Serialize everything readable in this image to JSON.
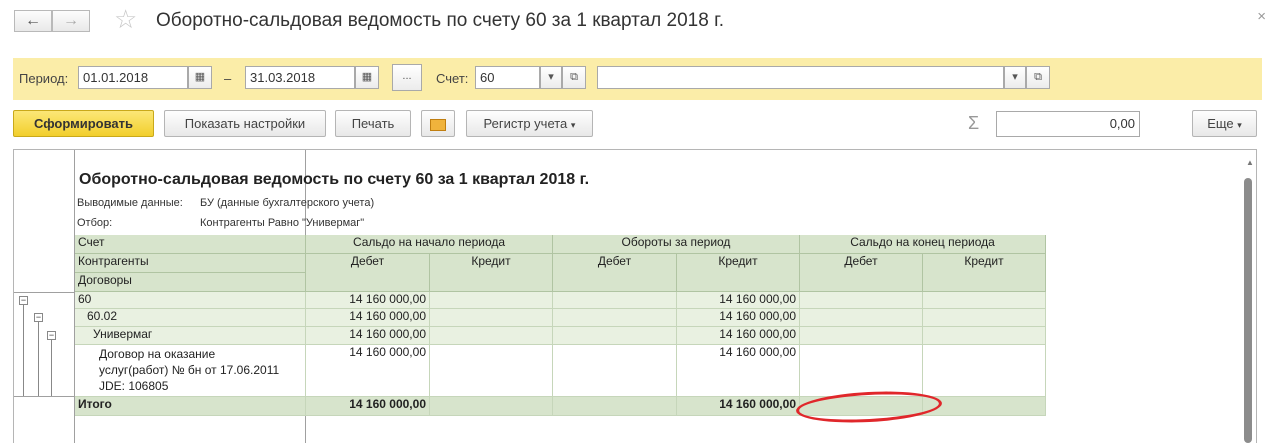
{
  "window": {
    "title": "Оборотно-сальдовая ведомость по счету 60 за 1 квартал 2018 г.",
    "back_icon": "←",
    "forward_icon": "→",
    "star_icon": "☆",
    "close_icon": "×"
  },
  "filters": {
    "period_label": "Период:",
    "date_from": "01.01.2018",
    "dash": "–",
    "date_to": "31.03.2018",
    "ellipsis_label": "...",
    "account_label": "Счет:",
    "account_value": "60",
    "subconto_value": ""
  },
  "toolbar": {
    "generate_label": "Сформировать",
    "settings_label": "Показать настройки",
    "print_label": "Печать",
    "register_label": "Регистр учета",
    "sum_icon": "Σ",
    "sum_value": "0,00",
    "more_label": "Еще"
  },
  "report": {
    "title": "Оборотно-сальдовая ведомость по счету 60 за 1 квартал 2018 г.",
    "output_label": "Выводимые данные:",
    "output_value": "БУ (данные бухгалтерского учета)",
    "filter_label": "Отбор:",
    "filter_value": "Контрагенты Равно \"Универмаг\"",
    "headers": {
      "account": "Счет",
      "counterparty": "Контрагенты",
      "contract": "Договоры",
      "opening_balance": "Сальдо на начало периода",
      "turnover": "Обороты за период",
      "closing_balance": "Сальдо на конец периода",
      "debit": "Дебет",
      "credit": "Кредит"
    },
    "rows": [
      {
        "name": "60",
        "open_debit": "14 160 000,00",
        "turn_credit": "14 160 000,00"
      },
      {
        "name": "60.02",
        "open_debit": "14 160 000,00",
        "turn_credit": "14 160 000,00"
      },
      {
        "name": "Универмаг",
        "open_debit": "14 160 000,00",
        "turn_credit": "14 160 000,00"
      },
      {
        "name_lines": [
          "Договор на оказание",
          "услуг(работ) № бн от 17.06.2011",
          "JDE: 106805"
        ],
        "open_debit": "14 160 000,00",
        "turn_credit": "14 160 000,00"
      }
    ],
    "total": {
      "name": "Итого",
      "open_debit": "14 160 000,00",
      "turn_credit": "14 160 000,00"
    }
  },
  "colors": {
    "panel_bg": "#fbeda8",
    "primary_button": "#f2cf2c",
    "header_green": "#d7e4cc",
    "row_green": "#e9f1e1",
    "annotation_red": "#e0272b"
  }
}
